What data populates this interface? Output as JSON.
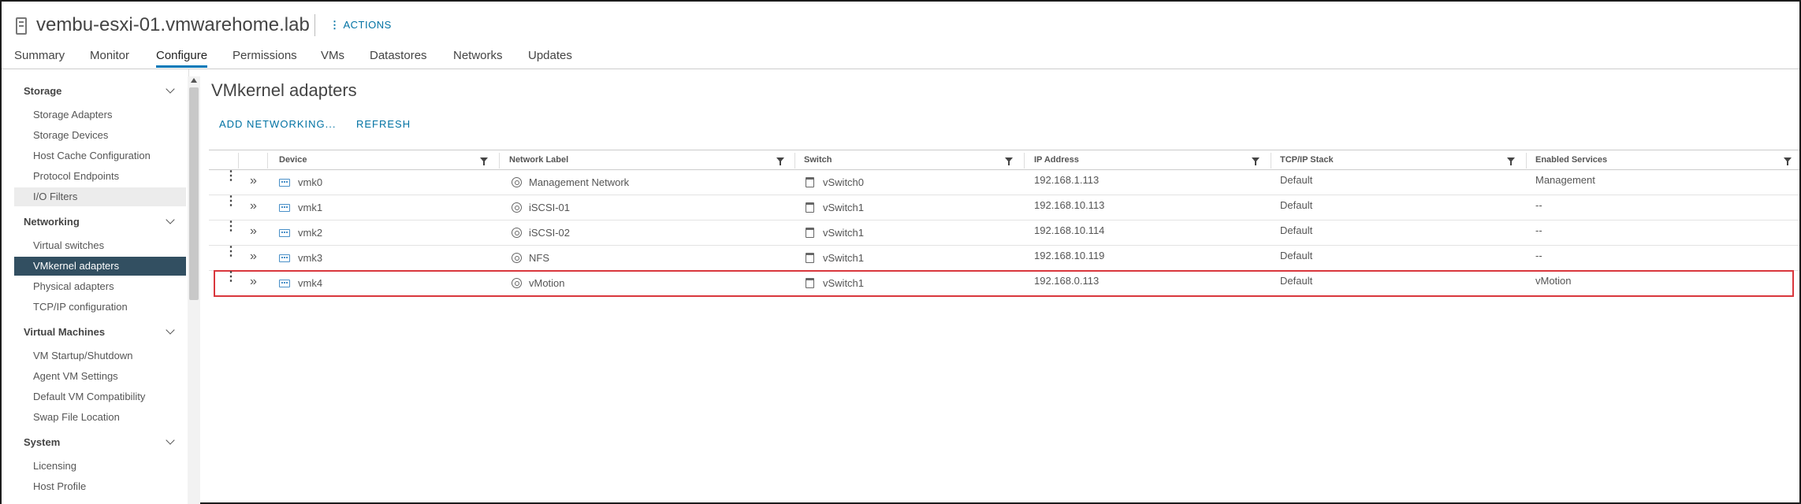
{
  "header": {
    "host_title": "vembu-esxi-01.vmwarehome.lab",
    "actions_label": "ACTIONS"
  },
  "tabs": [
    {
      "label": "Summary"
    },
    {
      "label": "Monitor"
    },
    {
      "label": "Configure",
      "active": true
    },
    {
      "label": "Permissions"
    },
    {
      "label": "VMs"
    },
    {
      "label": "Datastores"
    },
    {
      "label": "Networks"
    },
    {
      "label": "Updates"
    }
  ],
  "sidebar": {
    "sections": [
      {
        "title": "Storage",
        "items": [
          "Storage Adapters",
          "Storage Devices",
          "Host Cache Configuration",
          "Protocol Endpoints",
          "I/O Filters"
        ]
      },
      {
        "title": "Networking",
        "items": [
          "Virtual switches",
          "VMkernel adapters",
          "Physical adapters",
          "TCP/IP configuration"
        ]
      },
      {
        "title": "Virtual Machines",
        "items": [
          "VM Startup/Shutdown",
          "Agent VM Settings",
          "Default VM Compatibility",
          "Swap File Location"
        ]
      },
      {
        "title": "System",
        "items": [
          "Licensing",
          "Host Profile"
        ]
      }
    ],
    "selected_item": "VMkernel adapters",
    "hover_item": "I/O Filters"
  },
  "main": {
    "title": "VMkernel adapters",
    "add_networking_label": "ADD NETWORKING...",
    "refresh_label": "REFRESH"
  },
  "grid": {
    "columns": [
      "Device",
      "Network Label",
      "Switch",
      "IP Address",
      "TCP/IP Stack",
      "Enabled Services"
    ],
    "rows": [
      {
        "device": "vmk0",
        "network_label": "Management Network",
        "switch": "vSwitch0",
        "ip": "192.168.1.113",
        "stack": "Default",
        "services": "Management"
      },
      {
        "device": "vmk1",
        "network_label": "iSCSI-01",
        "switch": "vSwitch1",
        "ip": "192.168.10.113",
        "stack": "Default",
        "services": "--"
      },
      {
        "device": "vmk2",
        "network_label": "iSCSI-02",
        "switch": "vSwitch1",
        "ip": "192.168.10.114",
        "stack": "Default",
        "services": "--"
      },
      {
        "device": "vmk3",
        "network_label": "NFS",
        "switch": "vSwitch1",
        "ip": "192.168.10.119",
        "stack": "Default",
        "services": "--"
      },
      {
        "device": "vmk4",
        "network_label": "vMotion",
        "switch": "vSwitch1",
        "ip": "192.168.0.113",
        "stack": "Default",
        "services": "vMotion",
        "highlighted": true
      }
    ]
  },
  "colors": {
    "accent": "#0072a3",
    "selected_bg": "#324f61",
    "highlight_border": "#d9373d"
  }
}
